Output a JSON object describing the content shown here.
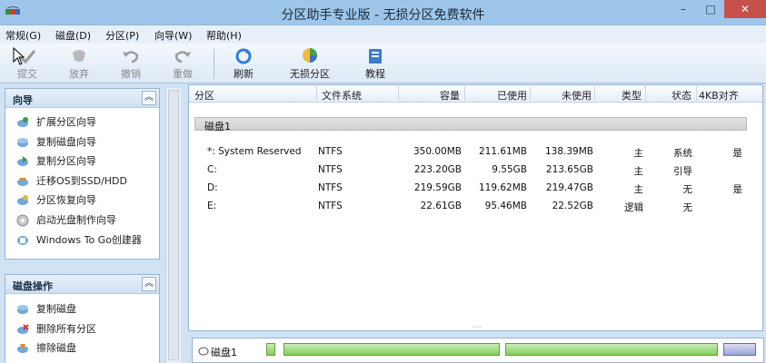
{
  "window": {
    "title": "分区助手专业版 - 无损分区免费软件",
    "buttons": {
      "minimize": "–",
      "maximize": "□",
      "close": "✕"
    }
  },
  "menu": [
    "常规(G)",
    "磁盘(D)",
    "分区(P)",
    "向导(W)",
    "帮助(H)"
  ],
  "toolbar": [
    {
      "label": "提交",
      "icon": "check-icon",
      "enabled": false
    },
    {
      "label": "放弃",
      "icon": "discard-icon",
      "enabled": false
    },
    {
      "label": "撤销",
      "icon": "undo-icon",
      "enabled": false
    },
    {
      "label": "重做",
      "icon": "redo-icon",
      "enabled": false
    },
    {
      "label": "刷新",
      "icon": "refresh-icon",
      "enabled": true
    },
    {
      "label": "无损分区",
      "icon": "lossless-partition-icon",
      "enabled": true
    },
    {
      "label": "教程",
      "icon": "tutorial-icon",
      "enabled": true
    }
  ],
  "wizard_panel": {
    "title": "向导",
    "collapse_glyph": "︽",
    "items": [
      "扩展分区向导",
      "复制磁盘向导",
      "复制分区向导",
      "迁移OS到SSD/HDD",
      "分区恢复向导",
      "启动光盘制作向导",
      "Windows To Go创建器"
    ]
  },
  "disk_ops_panel": {
    "title": "磁盘操作",
    "collapse_glyph": "︽",
    "items": [
      "复制磁盘",
      "删除所有分区",
      "擦除磁盘"
    ]
  },
  "table": {
    "columns": [
      "分区",
      "文件系统",
      "容量",
      "已使用",
      "未使用",
      "类型",
      "状态",
      "4KB对齐"
    ],
    "disk_label": "磁盘1",
    "rows": [
      {
        "partition": "*: System Reserved",
        "fs": "NTFS",
        "capacity": "350.00MB",
        "used": "211.61MB",
        "free": "138.39MB",
        "type": "主",
        "status": "系统",
        "align": "是"
      },
      {
        "partition": "C:",
        "fs": "NTFS",
        "capacity": "223.20GB",
        "used": "9.55GB",
        "free": "213.65GB",
        "type": "主",
        "status": "引导",
        "align": ""
      },
      {
        "partition": "D:",
        "fs": "NTFS",
        "capacity": "219.59GB",
        "used": "119.62MB",
        "free": "219.47GB",
        "type": "主",
        "status": "无",
        "align": "是"
      },
      {
        "partition": "E:",
        "fs": "NTFS",
        "capacity": "22.61GB",
        "used": "95.46MB",
        "free": "22.52GB",
        "type": "逻辑",
        "status": "无",
        "align": ""
      }
    ]
  },
  "disk_map": {
    "label": "磁盘1"
  },
  "colors": {
    "title_bar": "#9dc6ea",
    "close_button": "#c7504a",
    "partition_bar": "#7fcf5e",
    "selected_bar": "#9aa4d8"
  }
}
